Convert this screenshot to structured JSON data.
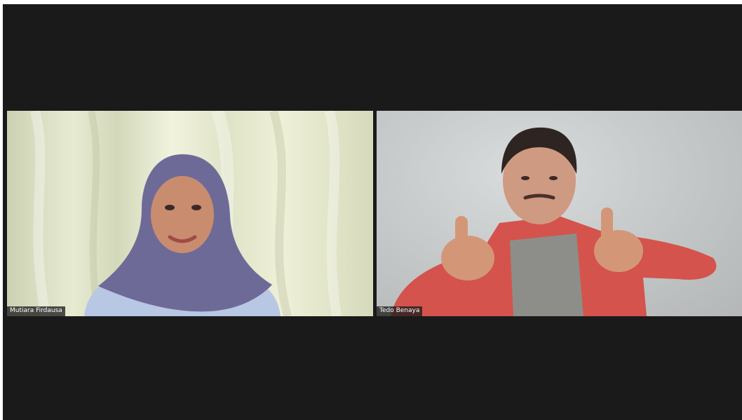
{
  "meeting": {
    "participants": [
      {
        "name": "Mutiara Firdausa"
      },
      {
        "name": "Tedo Benaya"
      }
    ]
  },
  "colors": {
    "background": "#1a1a1a",
    "name_label_bg": "#1e1e1e",
    "name_label_text": "#ffffff"
  }
}
